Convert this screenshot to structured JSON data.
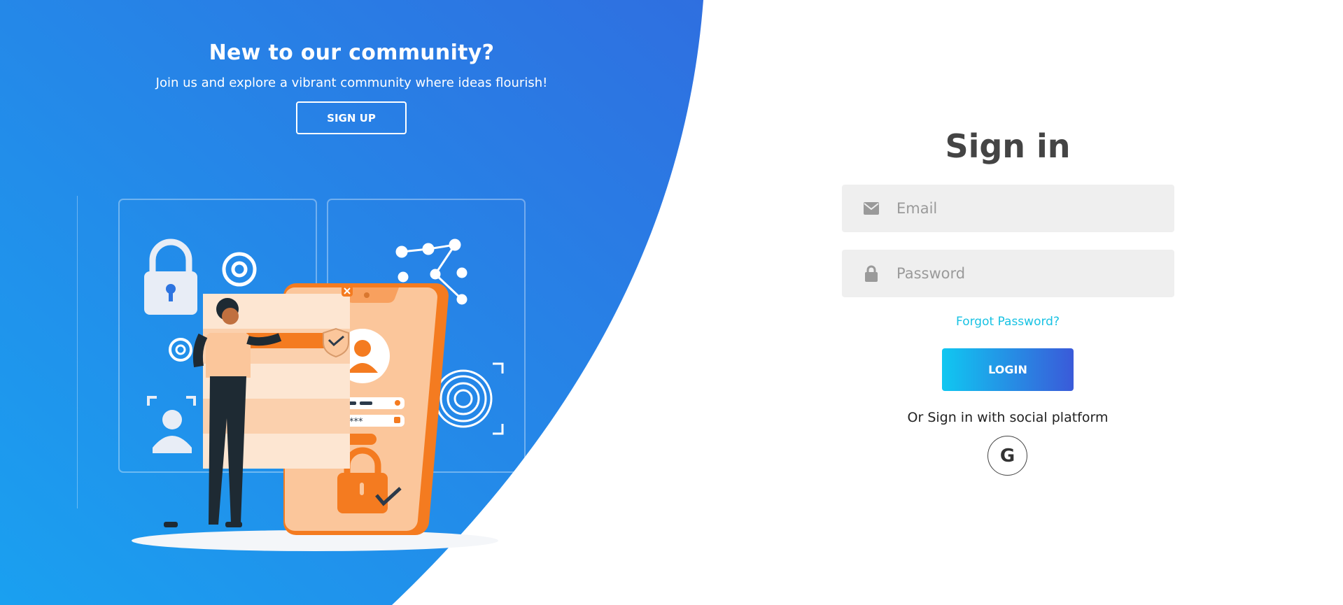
{
  "promo": {
    "title": "New to our community?",
    "subtitle": "Join us and explore a vibrant community where ideas flourish!",
    "signup_label": "SIGN UP"
  },
  "signin": {
    "title": "Sign in",
    "email_placeholder": "Email",
    "password_placeholder": "Password",
    "forgot_label": "Forgot Password?",
    "login_label": "LOGIN",
    "social_text": "Or Sign in with social platform",
    "google_label": "G"
  },
  "icons": {
    "email": "envelope-icon",
    "password": "lock-icon",
    "social": "google-icon"
  },
  "colors": {
    "panel_top": "#2f6fe0",
    "panel_bottom": "#1f9bf0",
    "accent_link": "#18c2e3",
    "login_gradient_start": "#10c7f1",
    "login_gradient_end": "#3a5ad9",
    "illustration_orange": "#f47b20",
    "illustration_peach": "#fbc69b"
  }
}
